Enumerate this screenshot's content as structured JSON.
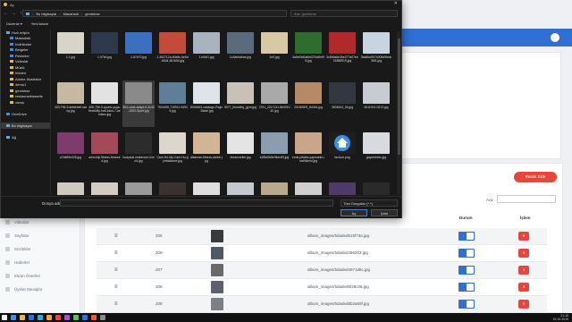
{
  "dialog": {
    "title": "Aç",
    "close_label": "✕",
    "breadcrumb": [
      "Bu bilgisayar",
      "Masaüstü",
      "gerekirse"
    ],
    "search_placeholder": "Ara: gerekirse",
    "cmd_organize": "Düzenle ▾",
    "cmd_new_folder": "Yeni klasör",
    "nav_items": [
      {
        "label": "Hızlı erişim",
        "type": "pc",
        "indent": false
      },
      {
        "label": "Masaüstü",
        "type": "blue",
        "indent": true
      },
      {
        "label": "İndirilenler",
        "type": "blue",
        "indent": true
      },
      {
        "label": "Belgeler",
        "type": "blue",
        "indent": true
      },
      {
        "label": "Resimler",
        "type": "blue",
        "indent": true
      },
      {
        "label": "Videolar",
        "type": "folder",
        "indent": true
      },
      {
        "label": "Müzik",
        "type": "folder",
        "indent": true
      },
      {
        "label": "hidden",
        "type": "folder",
        "indent": true
      },
      {
        "label": "Adobe Illustrator",
        "type": "folder",
        "indent": true
      },
      {
        "label": "demo1",
        "type": "folder",
        "indent": true
      },
      {
        "label": "gerekirse",
        "type": "folder",
        "indent": true
      },
      {
        "label": "restaurant/assets",
        "type": "folder",
        "indent": true
      },
      {
        "label": "views",
        "type": "folder",
        "indent": true
      },
      {
        "label": "",
        "type": "gap",
        "indent": false
      },
      {
        "label": "OneDrive",
        "type": "blue",
        "indent": false
      },
      {
        "label": "",
        "type": "gap",
        "indent": false
      },
      {
        "label": "Bu bilgisayar",
        "type": "pc",
        "indent": false,
        "selected": true
      },
      {
        "label": "",
        "type": "gap",
        "indent": false
      },
      {
        "label": "Ağ",
        "type": "pc",
        "indent": false
      }
    ],
    "files": [
      {
        "name": "1-1.jpg",
        "color": "#d9d4c8"
      },
      {
        "name": "1-97b0.jpg",
        "color": "#2d3a4e"
      },
      {
        "name": "1-67b70.jpg",
        "color": "#3c6fc0"
      },
      {
        "name": "1-462712a-b0a5c-6e5d-d0d4 d8-fb6d.jpg",
        "color": "#c44b3a"
      },
      {
        "name": "1-b0df1.jpg",
        "color": "#a8b3bf"
      },
      {
        "name": "1c3ab6dbae.jpg",
        "color": "#5a6b7c"
      },
      {
        "name": "2c9.jpg",
        "color": "#d8c9a4"
      },
      {
        "name": "3a5ef0d0a6b027bd5ef98.jpg",
        "color": "#2f6d2f"
      },
      {
        "name": "3c5b5a6e3be277a07ee01888919.jpg",
        "color": "#b02a2a"
      },
      {
        "name": "3ba6ba9074008d9fcbc36f1.jpg",
        "color": "#c8d4e0"
      },
      {
        "name": "403-796-5-kettlebell-swing.jpg",
        "color": "#c7b8a4"
      },
      {
        "name": "406-796-0-sports-yoga-flexibility-half-lotus-7-aerobics.jpg",
        "color": "#e2e2e2"
      },
      {
        "name": "504-cane-adapt-it-3140-2000-Sport.jpg",
        "color": "#8a8a8a",
        "selected": true
      },
      {
        "name": "752x395-715911-94949.jpg",
        "color": "#5f7f98"
      },
      {
        "name": "800x563-catalogs-Page-Made.jpg",
        "color": "#dfe4ea"
      },
      {
        "name": "9077_bhealthy_gym.jpg",
        "color": "#c9c0b6"
      },
      {
        "name": "7291_2017131-8b001040.jpg",
        "color": "#a9a9a9"
      },
      {
        "name": "20180909_84364.jpg",
        "color": "#b58a64"
      },
      {
        "name": "3904604_06.jpg",
        "color": "#333840"
      },
      {
        "name": "5011001-0013.jpg",
        "color": "#c8ccd2"
      },
      {
        "name": "a7b689e028.jpg",
        "color": "#7d3c6b"
      },
      {
        "name": "arkeoloji-fitness-featured.jpg",
        "color": "#a34a5a"
      },
      {
        "name": "bodysuit-makeover-kimmi.jpg",
        "color": "#2c2c2c"
      },
      {
        "name": "Cam-Ho-My-Cam-Hu-gymbalance.jpg",
        "color": "#dcd6cd"
      },
      {
        "name": "alkaman-fitness-center.jpg",
        "color": "#d2b594"
      },
      {
        "name": "dreamseller.jpg",
        "color": "#e4e4e4"
      },
      {
        "name": "e2f5a0b8e3fcb4f3.jpg",
        "color": "#8b9db0"
      },
      {
        "name": "evde-pilates-yapmanin-inceliklersi.jpg",
        "color": "#c7a68a"
      },
      {
        "name": "favicon.png",
        "color": "#1f1f1f",
        "is_favicon": true
      },
      {
        "name": "gaymeirekv.jpg",
        "color": "#d7dbe0"
      },
      {
        "name": "",
        "color": "#cfc9be"
      },
      {
        "name": "",
        "color": "#d4cbc2"
      },
      {
        "name": "",
        "color": "#9a9a9a"
      },
      {
        "name": "",
        "color": "#3a3230"
      },
      {
        "name": "",
        "color": "#e0dede"
      },
      {
        "name": "",
        "color": "#c5c8ce"
      },
      {
        "name": "",
        "color": "#b9a98e"
      },
      {
        "name": "",
        "color": "#cfcfcf"
      },
      {
        "name": "",
        "color": "#513a6a"
      },
      {
        "name": "",
        "color": "#2a2a2a"
      }
    ],
    "filename_label": "Dosya adı:",
    "filename_value": "",
    "filetype_value": "Tüm Dosyalar (*.*)",
    "open_label": "Aç",
    "cancel_label": "İptal"
  },
  "app": {
    "add_button": "Resim Ekle",
    "search_label": "Ara:",
    "col_status": "Durum",
    "col_delete": "İşlem",
    "sidebar_items": [
      "Videolar",
      "Sayfalar",
      "Sözlükler",
      "Haberler",
      "Ekran Önerleri",
      "Üyeler Mesajlar"
    ],
    "rows": [
      {
        "id": "205",
        "path": "album_images/5daded515f73a.jpg",
        "thumb_color": "#3a3a3a"
      },
      {
        "id": "206",
        "path": "album_images/5daded466203.jpg",
        "thumb_color": "#4d5a66"
      },
      {
        "id": "207",
        "path": "album_images/5daded4971d6c.jpg",
        "thumb_color": "#6a6a6a"
      },
      {
        "id": "208",
        "path": "album_images/5daded5f28c06.jpg",
        "thumb_color": "#5c6070"
      },
      {
        "id": "209",
        "path": "album_images/5daded6b2a69f.jpg",
        "thumb_color": "#7a8088"
      }
    ],
    "delete_label": "✕"
  },
  "taskbar": {
    "icons": [
      "#ffffff",
      "#3d8ee8",
      "#e8b84a",
      "#2f6fd6",
      "#1fb0e0",
      "#f0a830",
      "#e8453c",
      "#b04ad6",
      "#5ac05a",
      "#2f6fd6",
      "#e85c3c",
      "#888888"
    ],
    "time": "21:15",
    "date": "19.10.2019"
  }
}
